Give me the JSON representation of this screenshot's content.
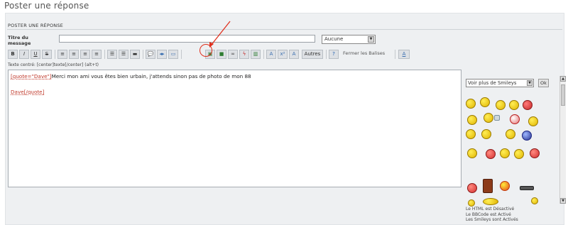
{
  "page": {
    "title": "Poster une réponse"
  },
  "panel": {
    "heading": "POSTER UNE RÉPONSE"
  },
  "subject": {
    "label": "Titre du message",
    "value": ""
  },
  "select": {
    "value": "Aucune"
  },
  "toolbar": {
    "bold": "B",
    "italic": "I",
    "underline": "U",
    "strike": "S",
    "others_label": "Autres",
    "close_tags_label": "Fermer les Balises",
    "font_label": "A"
  },
  "status_line": "Texte centré: [center]texte[/center] (alt+t)",
  "editor": {
    "line1_tag_open": "[quote=\"Dave\"]",
    "line1_text": "Merci mon ami vous êtes bien urbain, j'attends sinon pas de photo de mon 88",
    "line2_text": "Dave",
    "line2_tag_close": "[/quote]"
  },
  "smileys": {
    "select_value": "Voir plus de Smileys",
    "ok_label": "Ok"
  },
  "status_info": {
    "html": "Le HTML est Désactivé",
    "bbcode": "Le BBCode est Activé",
    "smileys": "Les Smileys sont Activés"
  },
  "colors": {
    "annotation": "#e0301e",
    "panel_bg": "#eef0f2",
    "tag_red": "#c0392b"
  }
}
